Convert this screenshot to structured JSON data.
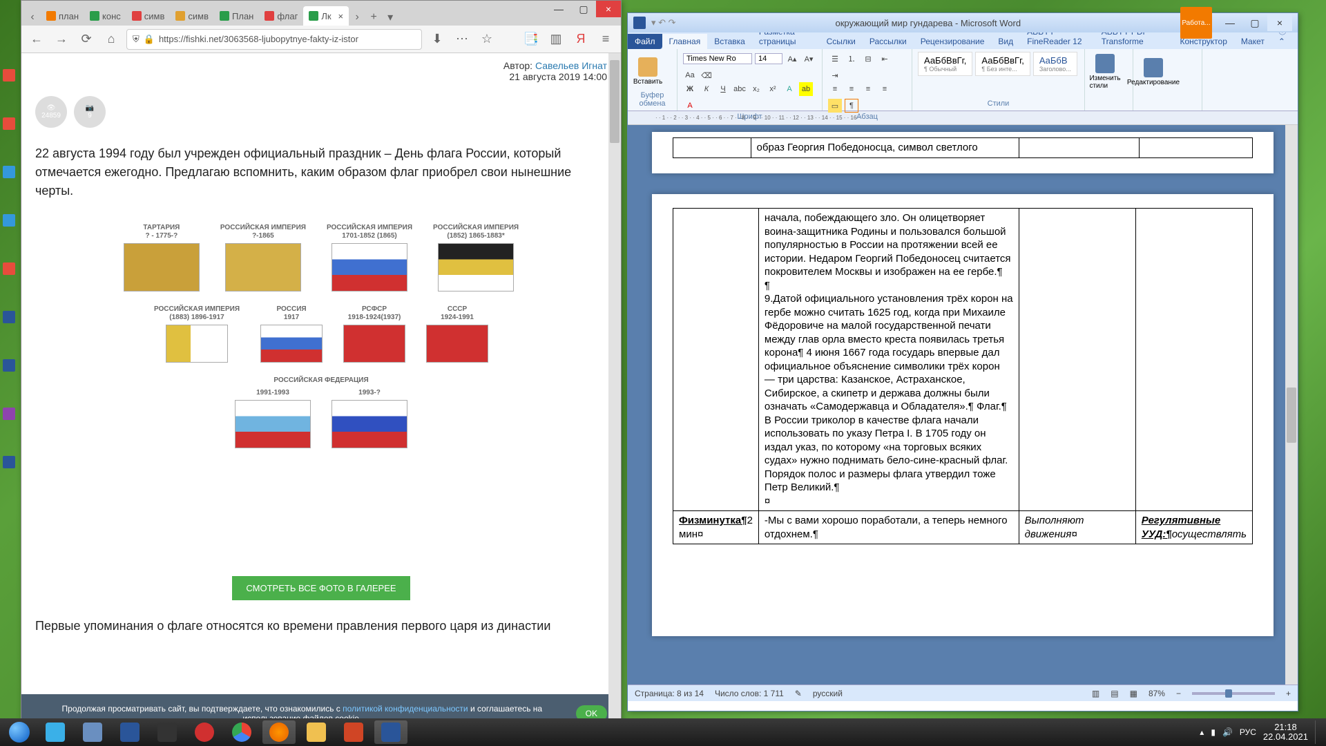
{
  "browser": {
    "tabs": [
      {
        "label": "план",
        "color": "#777"
      },
      {
        "label": "конс",
        "color": "#2a9d4a"
      },
      {
        "label": "симв",
        "color": "#e04040"
      },
      {
        "label": "симв",
        "color": "#e0a030"
      },
      {
        "label": "План",
        "color": "#2a9d4a"
      },
      {
        "label": "флаг",
        "color": "#e04040"
      },
      {
        "label": "Лк",
        "color": "#2a9d4a",
        "active": true
      }
    ],
    "url": "https://fishki.net/3063568-ljubopytnye-fakty-iz-istor",
    "author_label": "Автор:",
    "author": "Савельев Игнат",
    "date": "21 августа 2019 14:00",
    "views": "24859",
    "photos": "9",
    "paragraph1": "22 августа 1994 году был учрежден официальный праздник – День флага России, который отмечается ежегодно. Предлагаю вспомнить, каким образом флаг приобрел свои нынешние черты.",
    "flags": {
      "r1": [
        {
          "t": "ТАРТАРИЯ",
          "y": "? - 1775-?"
        },
        {
          "t": "РОССИЙСКАЯ ИМПЕРИЯ",
          "y": "?-1865"
        },
        {
          "t": "РОССИЙСКАЯ ИМПЕРИЯ",
          "y": "1701-1852 (1865)"
        },
        {
          "t": "РОССИЙСКАЯ ИМПЕРИЯ",
          "y": "(1852) 1865-1883*"
        }
      ],
      "r2": [
        {
          "t": "РОССИЙСКАЯ ИМПЕРИЯ",
          "y": "(1883) 1896-1917"
        },
        {
          "t": "РОССИЯ",
          "y": "1917"
        },
        {
          "t": "РСФСР",
          "y": "1918-1924(1937)"
        },
        {
          "t": "СССР",
          "y": "1924-1991"
        }
      ],
      "r3t": "РОССИЙСКАЯ ФЕДЕРАЦИЯ",
      "r3": [
        {
          "y": "1991-1993"
        },
        {
          "y": "1993-?"
        }
      ]
    },
    "gallery_btn": "СМОТРЕТЬ ВСЕ ФОТО В ГАЛЕРЕЕ",
    "paragraph2": "Первые упоминания о флаге относятся ко времени правления первого царя из династии",
    "cookie": {
      "text1": "Продолжая просматривать сайт, вы подтверждаете, что ознакомились с ",
      "link": "политикой конфиденциальности",
      "text2": " и соглашаетесь на использование файлов cookie.",
      "ok": "OK"
    }
  },
  "word": {
    "title": "окружающий мир гундарева - Microsoft Word",
    "table_mode": "Работа...",
    "tabs": [
      "Файл",
      "Главная",
      "Вставка",
      "Разметка страницы",
      "Ссылки",
      "Рассылки",
      "Рецензирование",
      "Вид",
      "ABBYY FineReader 12",
      "ABBYY PDF Transforme",
      "Конструктор",
      "Макет"
    ],
    "ribbon": {
      "clipboard": "Буфер обмена",
      "font": "Шрифт",
      "paragraph": "Абзац",
      "styles": "Стили",
      "editing": "Редактирование",
      "change_styles": "Изменить стили",
      "paste": "Вставить",
      "font_name": "Times New Ro",
      "font_size": "14",
      "style1": "АаБбВвГг,",
      "style2": "АаБбВвГг,",
      "style3": "АаБбВ",
      "s1sub": "¶ Обычный",
      "s2sub": "¶ Без инте...",
      "s3sub": "Заголово..."
    },
    "doc": {
      "line0": "образ Георгия Победоносца, символ светлого",
      "cell2a": "начала, побеждающего зло. Он олицетворяет воина-защитника Родины и пользовался большой популярностью в России на протяжении всей ее истории. Недаром Георгий Победоносец считается покровителем Москвы и изображен на ее гербе.¶",
      "cell2b": "9.Датой официального установления трёх корон на гербе можно считать 1625 год, когда при Михаиле Фёдоровиче на малой государственной печати между глав орла вместо креста появилась третья корона¶ 4 июня 1667 года государь впервые дал официальное объяснение символики трёх корон — три царства: Казанское, Астраханское, Сибирское, а скипетр и держава должны были означать «Самодержавца и Обладателя».¶ Флаг.¶ В России триколор в качестве флага начали использовать по указу Петра I. В 1705 году он издал указ, по которому «на торговых всяких судах» нужно поднимать бело-сине-красный флаг. Порядок полос и размеры флага утвердил тоже Петр Великий.¶",
      "row2c1a": "Физминутка¶",
      "row2c1b": "2 мин¤",
      "row2c2": "-Мы с вами хорошо поработали, а теперь немного отдохнем.¶",
      "row2c3": "Выполняют движения¤",
      "row2c4a": "Регулятивные УУД:¶",
      "row2c4b": "осуществлять"
    },
    "status": {
      "page": "Страница: 8 из 14",
      "words": "Число слов: 1 711",
      "lang": "русский",
      "zoom": "87%"
    }
  },
  "taskbar": {
    "time": "21:18",
    "date": "22.04.2021",
    "lang": "РУС"
  }
}
